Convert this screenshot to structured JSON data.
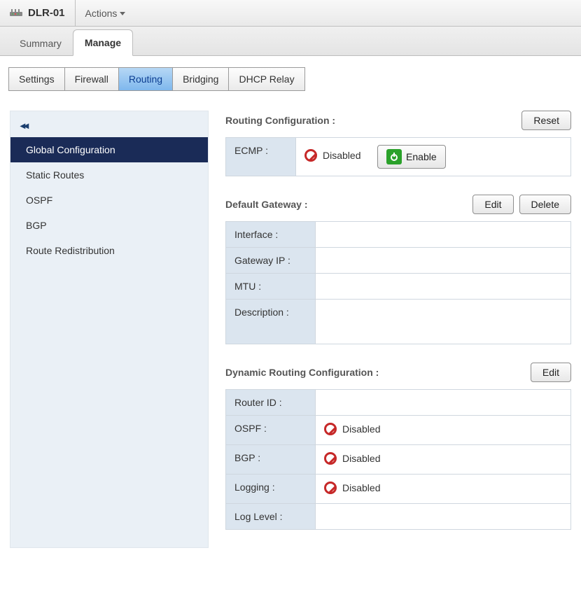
{
  "header": {
    "device_name": "DLR-01",
    "actions_label": "Actions"
  },
  "tabs": {
    "primary": [
      "Summary",
      "Manage"
    ],
    "active_primary": 1,
    "secondary": [
      "Settings",
      "Firewall",
      "Routing",
      "Bridging",
      "DHCP Relay"
    ],
    "active_secondary": 2
  },
  "sidebar": {
    "items": [
      "Global Configuration",
      "Static Routes",
      "OSPF",
      "BGP",
      "Route Redistribution"
    ],
    "active": 0
  },
  "sections": {
    "routing_config": {
      "title": "Routing Configuration :",
      "reset": "Reset",
      "ecmp_label": "ECMP :",
      "ecmp_status": "Disabled",
      "enable_label": "Enable"
    },
    "default_gateway": {
      "title": "Default Gateway :",
      "edit": "Edit",
      "delete": "Delete",
      "rows": {
        "interface_label": "Interface :",
        "interface_value": "",
        "gatewayip_label": "Gateway IP :",
        "gatewayip_value": "",
        "mtu_label": "MTU :",
        "mtu_value": "",
        "description_label": "Description :",
        "description_value": ""
      }
    },
    "dynamic_routing": {
      "title": "Dynamic Routing Configuration :",
      "edit": "Edit",
      "rows": {
        "routerid_label": "Router ID :",
        "routerid_value": "",
        "ospf_label": "OSPF :",
        "ospf_value": "Disabled",
        "bgp_label": "BGP :",
        "bgp_value": "Disabled",
        "logging_label": "Logging :",
        "logging_value": "Disabled",
        "loglevel_label": "Log Level :",
        "loglevel_value": ""
      }
    }
  }
}
